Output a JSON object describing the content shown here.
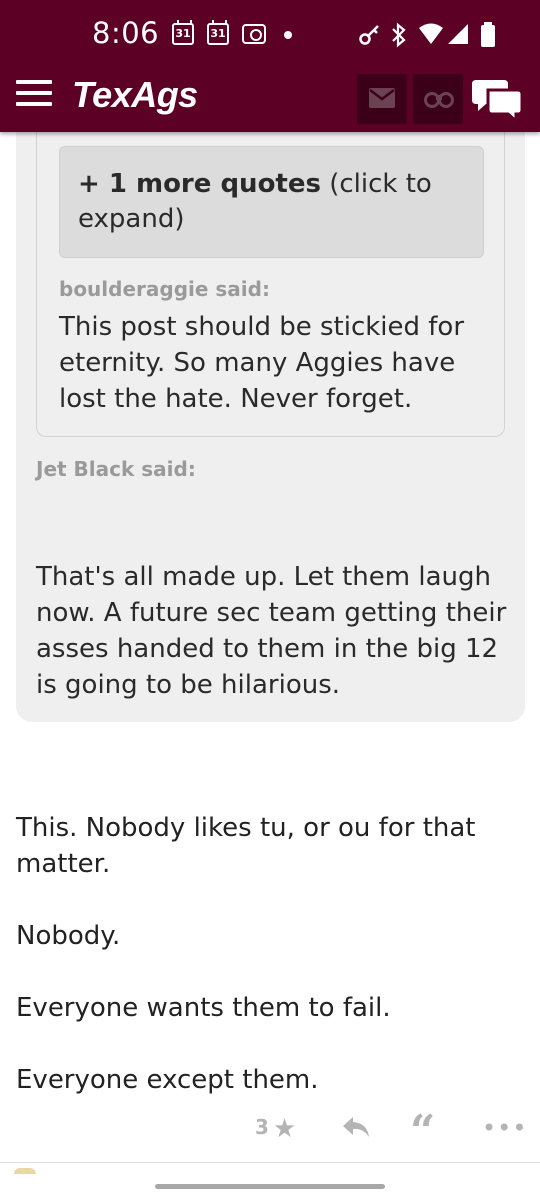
{
  "status_bar": {
    "time": "8:06",
    "calendar_day_1": "31",
    "calendar_day_2": "31"
  },
  "app_bar": {
    "logo": "TexAgs",
    "icons": [
      "menu-icon",
      "mail-icon",
      "binoculars-icon",
      "chat-icon"
    ],
    "brand_color": "#5d0025"
  },
  "thread": {
    "more_quotes_bold": "+ 1 more quotes",
    "more_quotes_rest": " (click to expand)",
    "inner_quote": {
      "author": "boulderaggie said:",
      "body": "This post should be stickied for eternity. So many Aggies have lost the hate. Never forget."
    },
    "outer_quote": {
      "author": "Jet Black said:",
      "body": "That's all made up. Let them laugh now. A future sec team getting their asses handed to them in the big 12 is going to be hilarious."
    },
    "post_paragraphs": [
      "This. Nobody likes tu, or ou for that matter.",
      "Nobody.",
      "Everyone wants them to fail.",
      "Everyone except them."
    ],
    "actions": {
      "star_count": "3",
      "icons": [
        "star-icon",
        "reply-icon",
        "quote-icon",
        "more-icon"
      ]
    }
  }
}
